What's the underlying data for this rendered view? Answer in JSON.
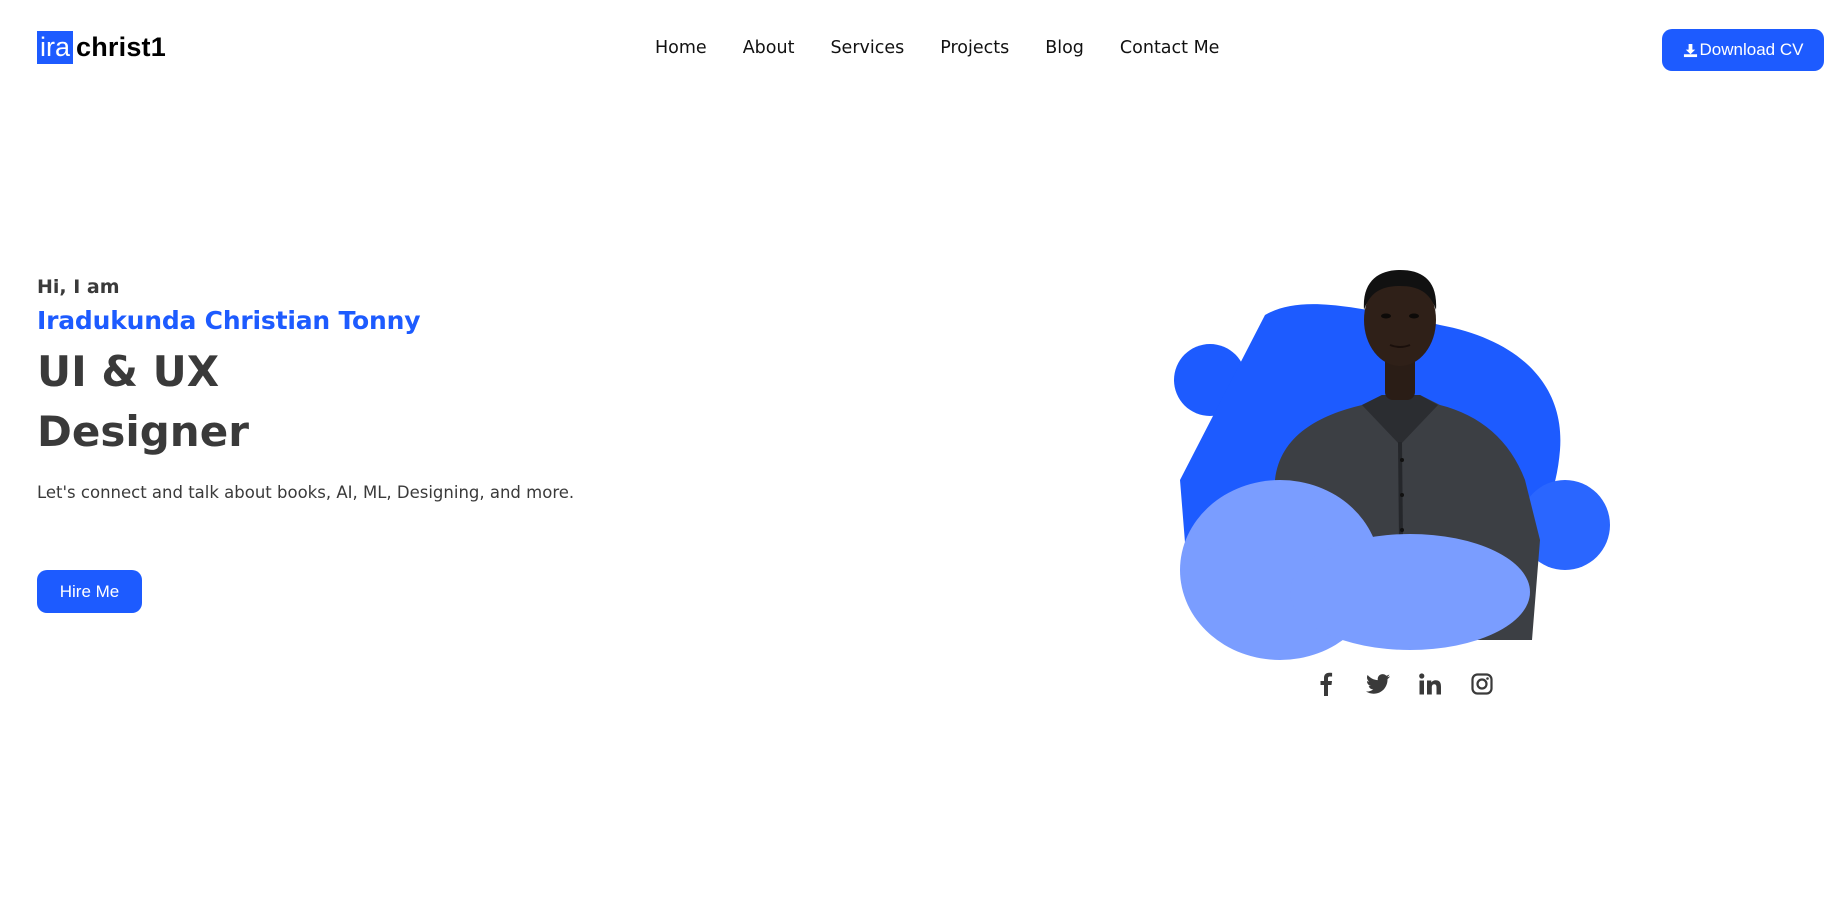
{
  "header": {
    "logo_box": "ira",
    "logo_text": "christ1",
    "nav": [
      "Home",
      "About",
      "Services",
      "Projects",
      "Blog",
      "Contact Me"
    ],
    "download_label": "Download CV",
    "download_icon": "download-icon"
  },
  "hero": {
    "greeting": "Hi, I am",
    "name": "Iradukunda Christian Tonny",
    "role_line1": "UI & UX",
    "role_line2": "Designer",
    "tagline": "Let's connect and talk about books, AI, ML, Designing, and more.",
    "hire_label": "Hire Me"
  },
  "colors": {
    "accent": "#1d5bff",
    "accent_light": "#7a9dff",
    "text_dark": "#3a3a3a"
  },
  "socials": [
    "facebook-icon",
    "twitter-icon",
    "linkedin-icon",
    "instagram-icon"
  ]
}
